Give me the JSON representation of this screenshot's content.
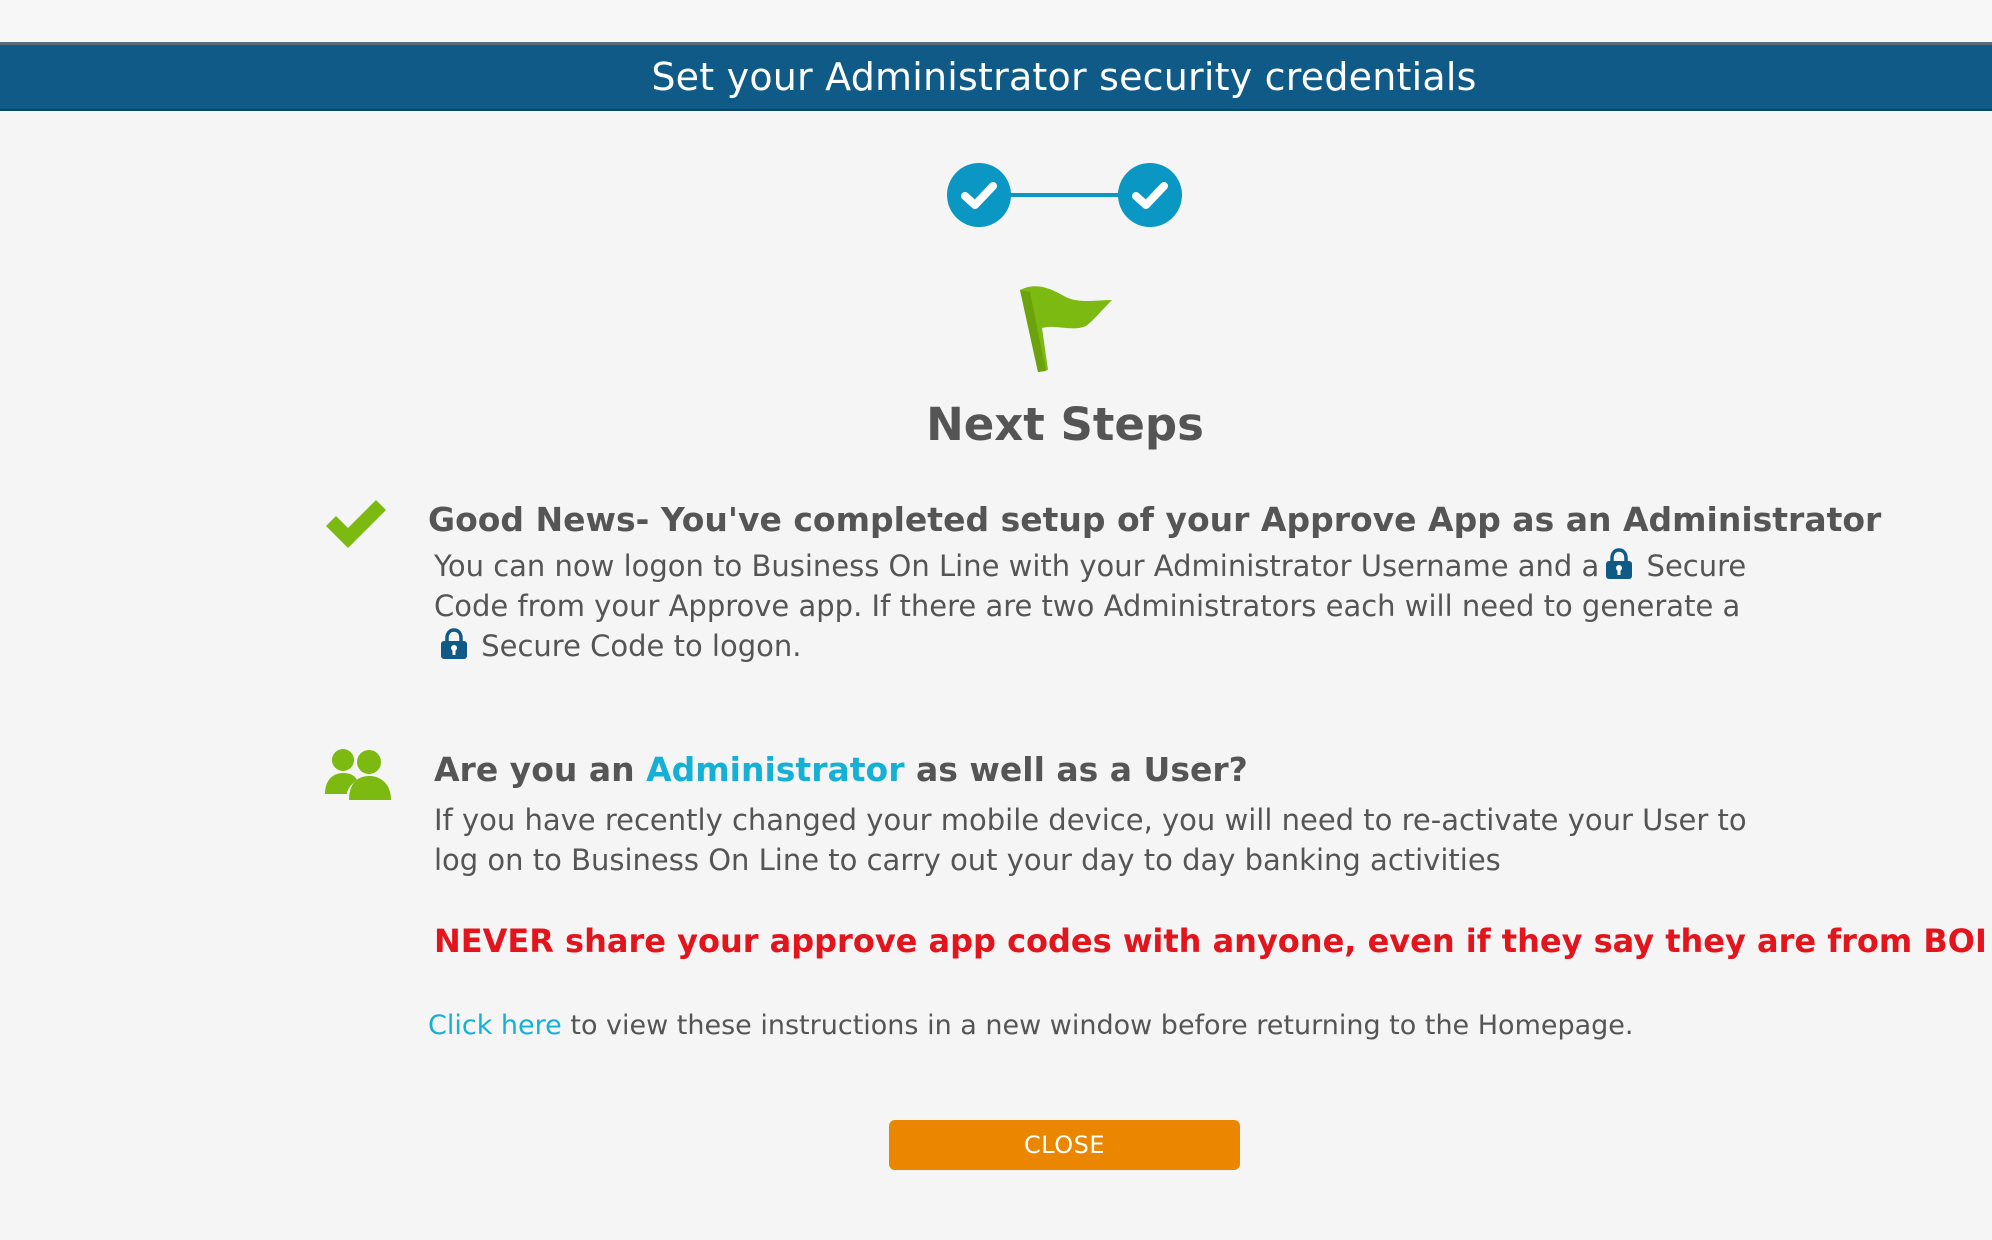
{
  "header": {
    "title": "Set your Administrator security credentials"
  },
  "stepper": {
    "steps": [
      "completed",
      "completed"
    ],
    "step_icon": "check-icon",
    "color": "#0a97c4"
  },
  "main": {
    "flag_icon": "flag-icon",
    "heading": "Next Steps",
    "accent_green": "#7cba12",
    "section_admin_done": {
      "icon": "check-icon",
      "heading": "Good News- You've completed setup of your Approve App as an Administrator",
      "body_part1": "You can now logon to Business On Line with your Administrator Username and a",
      "body_part2": "Secure Code from your Approve app. If there are two Administrators each will need to generate a",
      "body_part3": "Secure Code to logon.",
      "lock_icon": "lock-icon"
    },
    "section_user": {
      "icon": "users-icon",
      "heading_prefix": "Are you an",
      "heading_link": "Administrator",
      "heading_suffix": "as well as a User?",
      "body": "If you have recently changed your mobile device, you will need to re-activate your User to log on to Business On Line to carry out your day to day banking activities"
    },
    "warning": "NEVER share your approve app codes with anyone, even if they say they are from BOI",
    "warning_color": "#e3141c",
    "instructions": {
      "link": "Click here",
      "text": "to view these instructions in a new window before returning to the Homepage."
    },
    "link_color": "#15b0d6"
  },
  "footer": {
    "close_label": "CLOSE",
    "close_color": "#ea8600"
  }
}
